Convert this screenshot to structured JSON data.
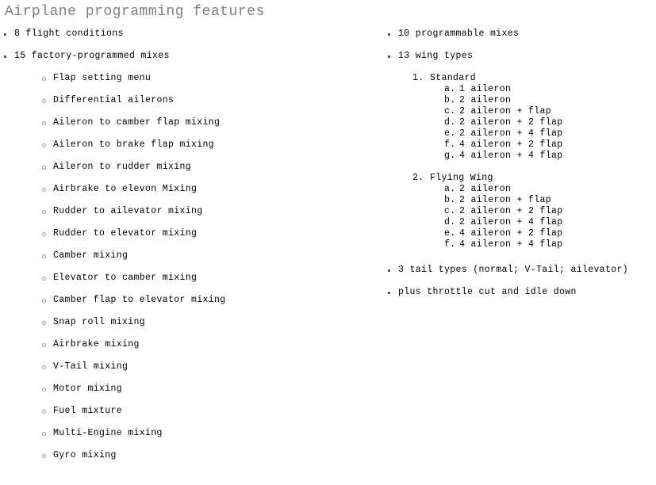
{
  "slide": {
    "title": "Airplane programming features",
    "title_color": "#808080",
    "background_color": "#ffffff",
    "text_color": "#000000"
  },
  "left_column": {
    "items": [
      {
        "label": "8 flight conditions"
      },
      {
        "label": "15 factory-programmed mixes"
      }
    ],
    "sub_items": [
      {
        "label": "Flap setting menu"
      },
      {
        "label": "Differential ailerons"
      },
      {
        "label": "Aileron to camber flap mixing"
      },
      {
        "label": "Aileron to brake flap mixing"
      },
      {
        "label": "Aileron to rudder mixing"
      },
      {
        "label": "Airbrake to elevon Mixing"
      },
      {
        "label": "Rudder to ailevator mixing"
      },
      {
        "label": "Rudder to elevator mixing"
      },
      {
        "label": "Camber mixing"
      },
      {
        "label": "Elevator to camber mixing"
      },
      {
        "label": "Camber flap to elevator mixing"
      },
      {
        "label": "Snap roll mixing"
      },
      {
        "label": "Airbrake mixing"
      },
      {
        "label": "V-Tail mixing"
      },
      {
        "label": "Motor mixing"
      },
      {
        "label": "Fuel mixture"
      },
      {
        "label": "Multi-Engine mixing"
      },
      {
        "label": "Gyro mixing"
      }
    ]
  },
  "right_column": {
    "items_top": [
      {
        "label": "10 programmable mixes"
      },
      {
        "label": "13 wing types"
      }
    ],
    "wing_types": [
      {
        "marker": "1.",
        "label": "Standard",
        "options": [
          {
            "marker": "a.",
            "label": "1 aileron"
          },
          {
            "marker": "b.",
            "label": "2 aileron"
          },
          {
            "marker": "c.",
            "label": "2 aileron + flap"
          },
          {
            "marker": "d.",
            "label": "2 aileron + 2 flap"
          },
          {
            "marker": "e.",
            "label": "2 aileron + 4 flap"
          },
          {
            "marker": "f.",
            "label": "4 aileron + 2 flap"
          },
          {
            "marker": "g.",
            "label": "4 aileron + 4 flap"
          }
        ]
      },
      {
        "marker": "2.",
        "label": "Flying Wing",
        "options": [
          {
            "marker": "a.",
            "label": "2 aileron"
          },
          {
            "marker": "b.",
            "label": "2 aileron + flap"
          },
          {
            "marker": "c.",
            "label": "2 aileron + 2 flap"
          },
          {
            "marker": "d.",
            "label": "2 aileron + 4 flap"
          },
          {
            "marker": "e.",
            "label": "4 aileron + 2 flap"
          },
          {
            "marker": "f.",
            "label": "4 aileron + 4 flap"
          }
        ]
      }
    ],
    "items_bottom": [
      {
        "label": "3 tail types (normal; V-Tail; ailevator)"
      },
      {
        "label": "plus throttle cut and idle down"
      }
    ]
  }
}
